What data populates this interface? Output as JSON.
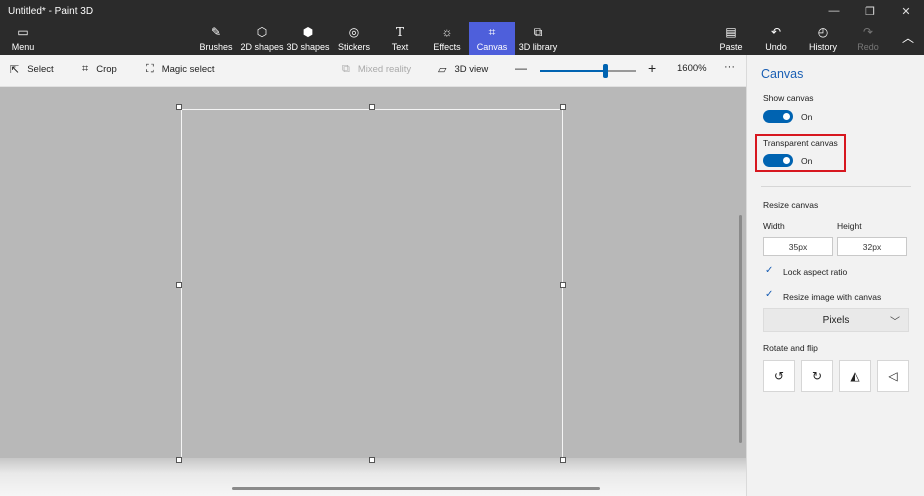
{
  "window": {
    "title": "Untitled* - Paint 3D",
    "minimize": "—",
    "restore": "❐",
    "close": "✕"
  },
  "ribbon": {
    "menu": "Menu",
    "tools": [
      {
        "label": "Brushes",
        "icon": "brush-icon",
        "glyph": "🖌"
      },
      {
        "label": "2D shapes",
        "icon": "2d-shapes-icon",
        "glyph": "⬡"
      },
      {
        "label": "3D shapes",
        "icon": "3d-shapes-icon",
        "glyph": "⬢"
      },
      {
        "label": "Stickers",
        "icon": "stickers-icon",
        "glyph": "◎"
      },
      {
        "label": "Text",
        "icon": "text-icon",
        "glyph": "T"
      },
      {
        "label": "Effects",
        "icon": "effects-icon",
        "glyph": "☼"
      },
      {
        "label": "Canvas",
        "icon": "canvas-icon",
        "glyph": "⌗"
      },
      {
        "label": "3D library",
        "icon": "3d-library-icon",
        "glyph": "⧉"
      }
    ],
    "paste": "Paste",
    "undo": "Undo",
    "history": "History",
    "redo": "Redo",
    "active_tab": "Canvas"
  },
  "commandbar": {
    "select": "Select",
    "crop": "Crop",
    "magic_select": "Magic select",
    "mixed_reality": "Mixed reality",
    "view_3d": "3D view",
    "zoom_minus": "—",
    "zoom_plus": "+",
    "zoom_level": "1600%",
    "zoom_slider_fraction": 0.68,
    "more": "···"
  },
  "panel": {
    "title": "Canvas",
    "show_canvas": {
      "label": "Show canvas",
      "state": "On"
    },
    "transparent_canvas": {
      "label": "Transparent canvas",
      "state": "On"
    },
    "resize_heading": "Resize canvas",
    "width_label": "Width",
    "height_label": "Height",
    "width_value": "35px",
    "height_value": "32px",
    "lock_aspect": "Lock aspect ratio",
    "resize_image": "Resize image with canvas",
    "units": "Pixels",
    "rotate_heading": "Rotate and flip"
  },
  "colors": {
    "accent": "#0063b1",
    "active_tab": "#4e5fdb",
    "highlight_box": "#d7171f"
  }
}
